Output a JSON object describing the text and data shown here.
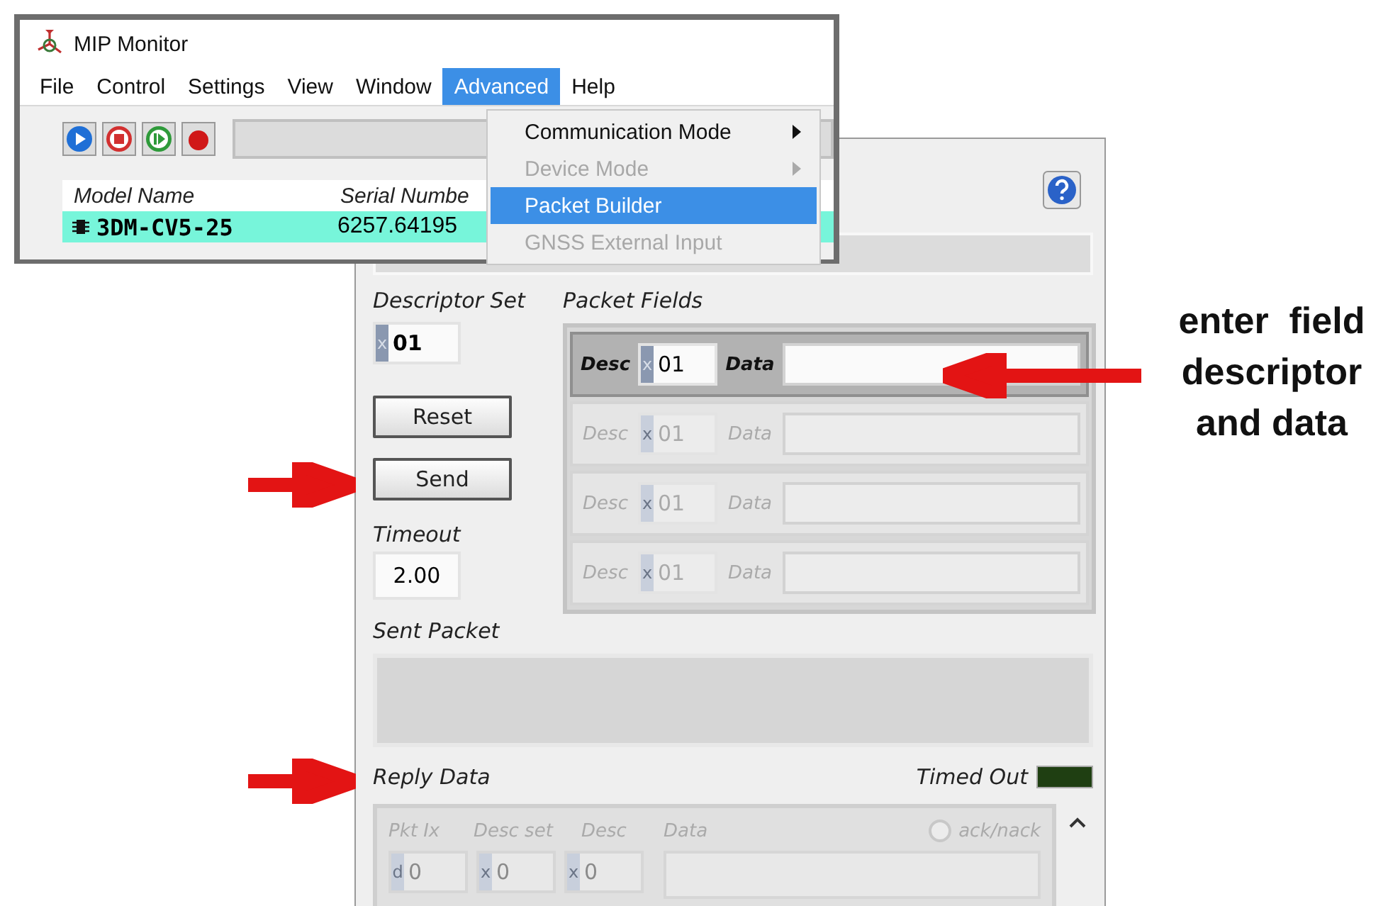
{
  "main_window": {
    "title": "MIP Monitor",
    "menu": [
      {
        "label": "File",
        "selected": false
      },
      {
        "label": "Control",
        "selected": false
      },
      {
        "label": "Settings",
        "selected": false
      },
      {
        "label": "View",
        "selected": false
      },
      {
        "label": "Window",
        "selected": false
      },
      {
        "label": "Advanced",
        "selected": true
      },
      {
        "label": "Help",
        "selected": false
      }
    ],
    "toolbar_buttons": [
      {
        "kind": "play"
      },
      {
        "kind": "stop"
      },
      {
        "kind": "step"
      },
      {
        "kind": "record"
      }
    ],
    "device_table": {
      "columns": [
        "Model Name",
        "Serial Numbe"
      ],
      "rows": [
        {
          "cells": [
            "3DM-CV5-25",
            "6257.64195"
          ],
          "selected": true
        }
      ]
    }
  },
  "menu_dropdown": {
    "items": [
      {
        "label": "Communication Mode",
        "disabled": false,
        "submenu": true,
        "selected": false
      },
      {
        "label": "Device Mode",
        "disabled": true,
        "submenu": true,
        "selected": false
      },
      {
        "label": "Packet Builder",
        "disabled": false,
        "submenu": false,
        "selected": true
      },
      {
        "label": "GNSS External Input",
        "disabled": true,
        "submenu": false,
        "selected": false
      }
    ]
  },
  "packet_builder": {
    "descriptor_set_label": "Descriptor Set",
    "descriptor_set": {
      "radix": "x",
      "value": "01"
    },
    "reset_button": "Reset",
    "send_button": "Send",
    "timeout_label": "Timeout",
    "timeout": "2.00",
    "packet_fields_label": "Packet Fields",
    "fields": [
      {
        "desc_label": "Desc",
        "radix": "x",
        "desc": "01",
        "data_label": "Data",
        "disabled": false
      },
      {
        "desc_label": "Desc",
        "radix": "x",
        "desc": "01",
        "data_label": "Data",
        "disabled": true
      },
      {
        "desc_label": "Desc",
        "radix": "x",
        "desc": "01",
        "data_label": "Data",
        "disabled": true
      },
      {
        "desc_label": "Desc",
        "radix": "x",
        "desc": "01",
        "data_label": "Data",
        "disabled": true
      }
    ],
    "sent_packet_label": "Sent Packet",
    "reply_data_label": "Reply Data",
    "timed_out_label": "Timed Out",
    "timed_out_on": false,
    "reply_columns": [
      "Pkt Ix",
      "Desc set",
      "Desc",
      "Data"
    ],
    "ack_label": "ack/nack",
    "reply_row": [
      {
        "radix": "d",
        "value": "0"
      },
      {
        "radix": "x",
        "value": "0"
      },
      {
        "radix": "x",
        "value": "0"
      }
    ]
  },
  "annotation": {
    "lines": [
      "enter  field",
      "descriptor",
      "and data"
    ]
  }
}
